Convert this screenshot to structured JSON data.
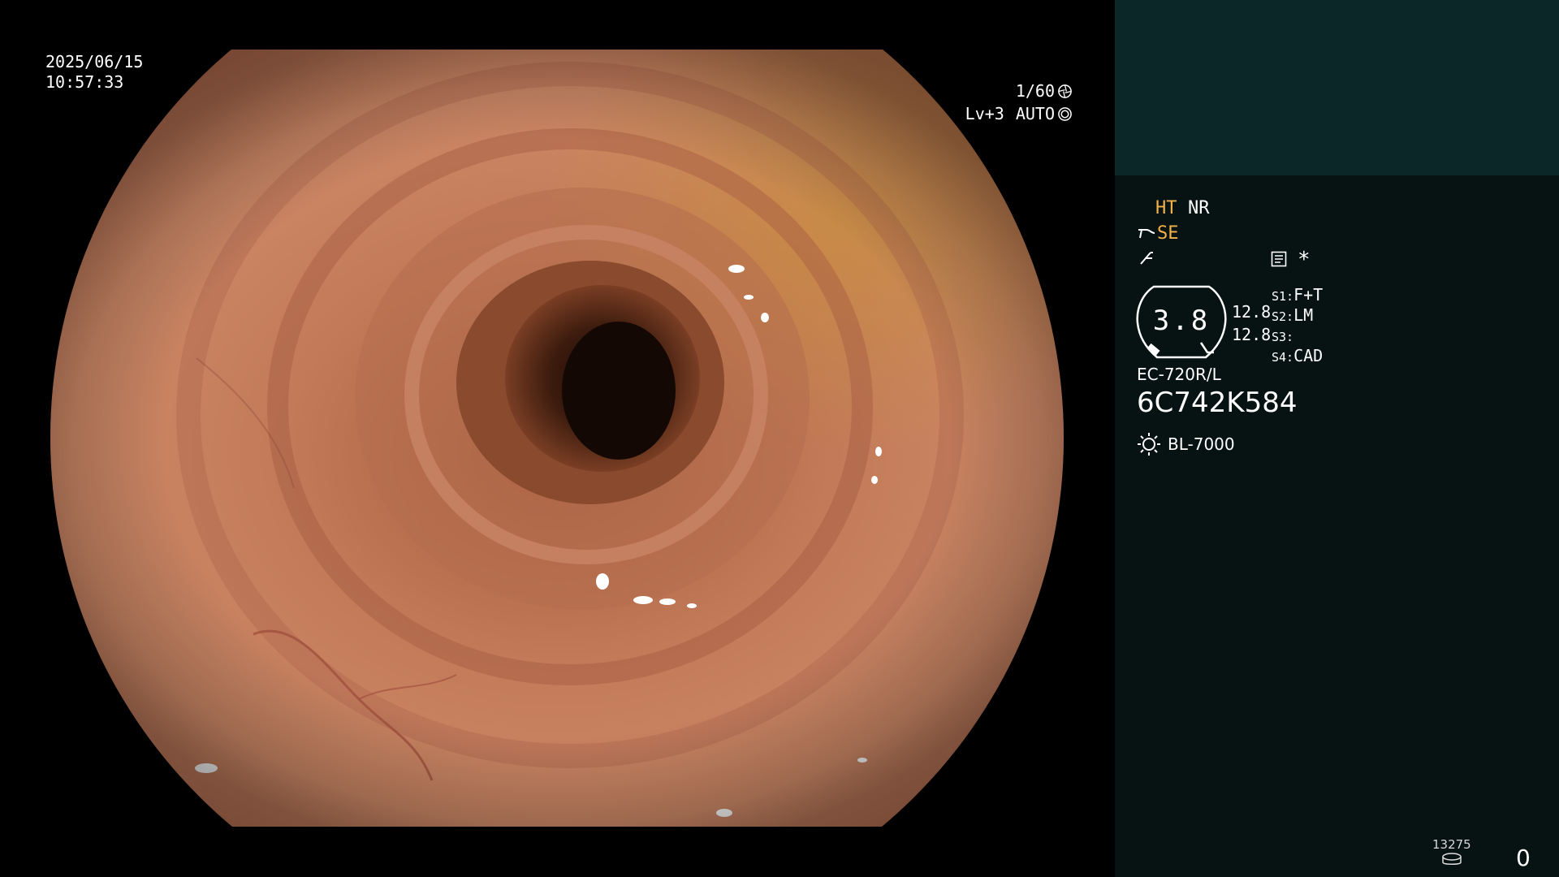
{
  "datetime": {
    "date": "2025/06/15",
    "time": "10:57:33"
  },
  "camera": {
    "shutter": "1/60",
    "shutter_icon": "aperture-icon",
    "enhance_level": "Lv+3",
    "iris_mode": "AUTO",
    "iris_icon": "iris-ring-icon"
  },
  "image_processing": {
    "ht_label": "HT",
    "nr_label": "NR",
    "se_label": "SE",
    "se_icon": "scope-tip-icon",
    "fn_icon": "function-hook-icon",
    "memo_icon": "note-icon",
    "star_label": "*"
  },
  "zoom": {
    "value": "3.8",
    "left_scale_a": "12.8",
    "left_scale_b": "12.8"
  },
  "switches": [
    {
      "key": "S1:",
      "value": "F+T"
    },
    {
      "key": "S2:",
      "value": "LM"
    },
    {
      "key": "S3:",
      "value": ""
    },
    {
      "key": "S4:",
      "value": "CAD"
    }
  ],
  "scope": {
    "model": "EC-720R/L",
    "serial": "6C742K584",
    "light_source": "BL-7000",
    "light_icon": "sun-icon"
  },
  "storage": {
    "remaining": "13275",
    "capture_count": "0",
    "icon": "disk-icon"
  },
  "colors": {
    "panel_bg": "#071212",
    "panel_top_bg": "#0c2727",
    "amber": "#f4b24a",
    "mucosa": "#c77c5c"
  }
}
